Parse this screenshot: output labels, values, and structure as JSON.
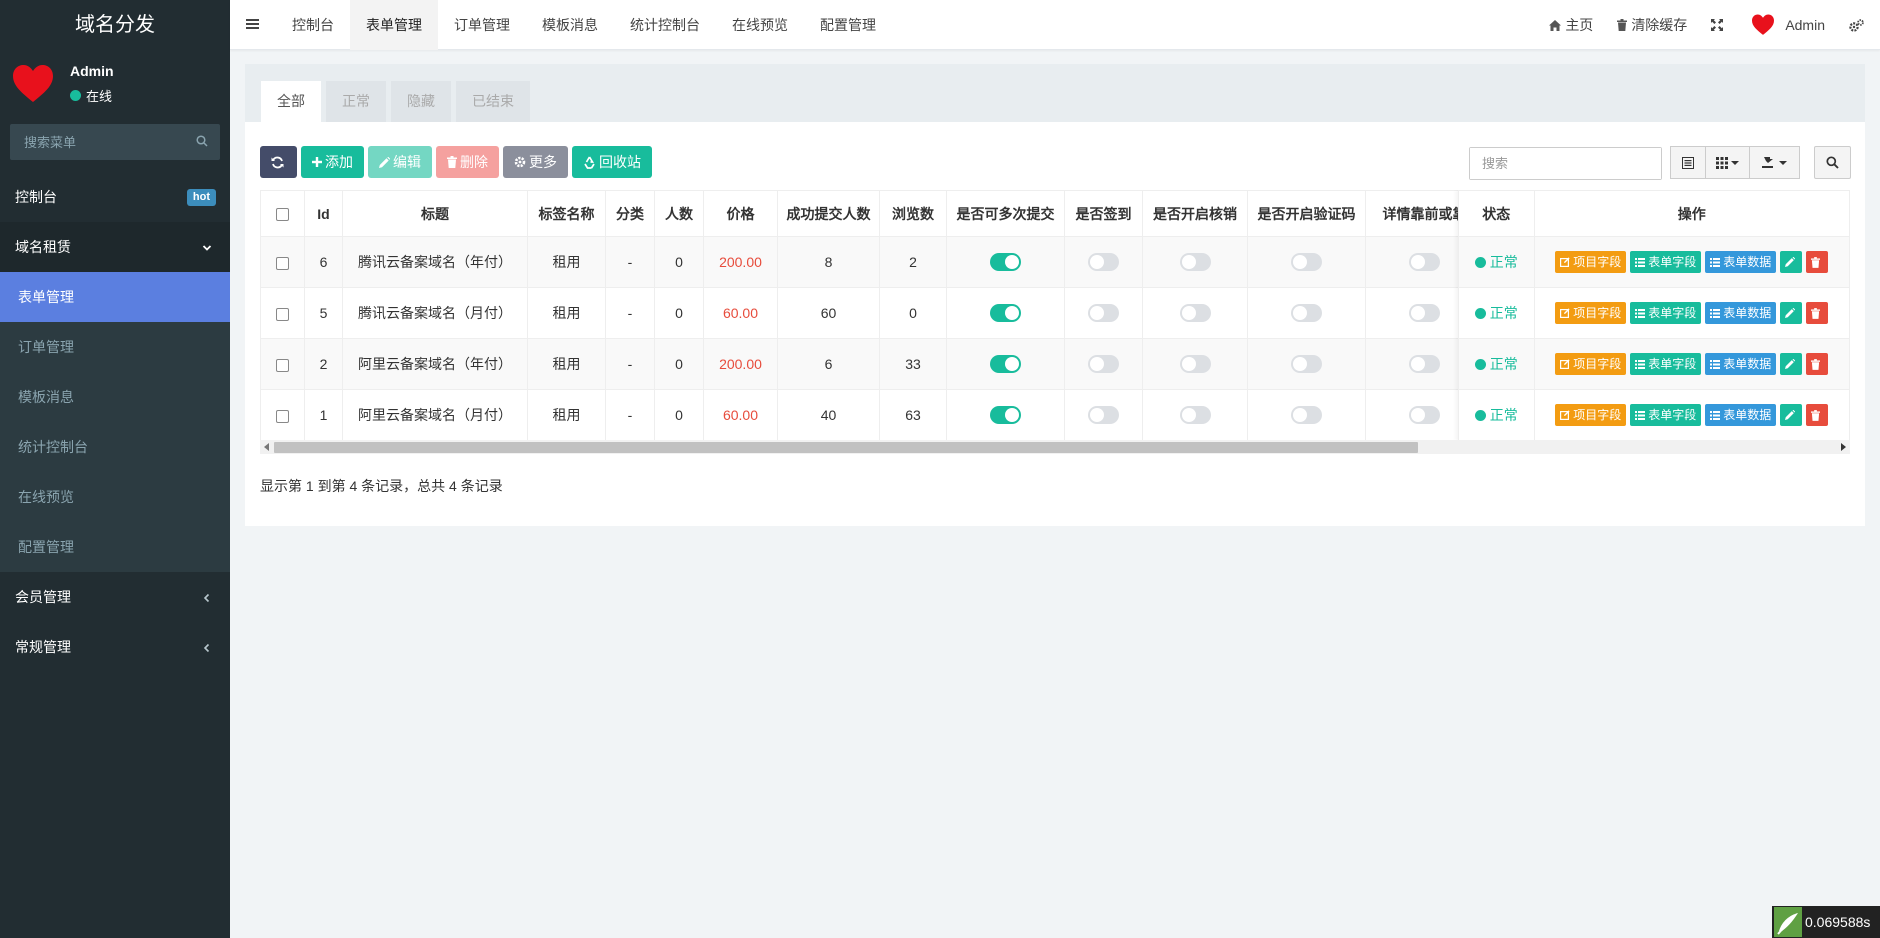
{
  "sidebar": {
    "logo": "域名分发",
    "user": {
      "name": "Admin",
      "status": "在线"
    },
    "search_placeholder": "搜索菜单",
    "dashboard": {
      "label": "控制台",
      "badge": "hot"
    },
    "group": {
      "label": "域名租赁"
    },
    "subitems": [
      "表单管理",
      "订单管理",
      "模板消息",
      "统计控制台",
      "在线预览",
      "配置管理"
    ],
    "member": "会员管理",
    "general": "常规管理"
  },
  "topbar": {
    "tabs": [
      "控制台",
      "表单管理",
      "订单管理",
      "模板消息",
      "统计控制台",
      "在线预览",
      "配置管理"
    ],
    "home": "主页",
    "clear_cache": "清除缓存",
    "user": "Admin"
  },
  "panel": {
    "tabs": [
      "全部",
      "正常",
      "隐藏",
      "已结束"
    ],
    "buttons": {
      "add": "添加",
      "edit": "编辑",
      "delete": "删除",
      "more": "更多",
      "recycle": "回收站"
    },
    "search_placeholder": "搜索"
  },
  "table": {
    "headers": [
      "Id",
      "标题",
      "标签名称",
      "分类",
      "人数",
      "价格",
      "成功提交人数",
      "浏览数",
      "是否可多次提交",
      "是否签到",
      "是否开启核销",
      "是否开启验证码",
      "详情靠前或靠"
    ],
    "fixed_headers": [
      "状态",
      "操作"
    ],
    "rows": [
      {
        "id": "6",
        "title": "腾讯云备案域名（年付）",
        "tag": "租用",
        "category": "-",
        "people": "0",
        "price": "200.00",
        "success": "8",
        "views": "2",
        "multi": true,
        "signin": false,
        "verify": false,
        "captcha": false,
        "front": false,
        "status": "正常"
      },
      {
        "id": "5",
        "title": "腾讯云备案域名（月付）",
        "tag": "租用",
        "category": "-",
        "people": "0",
        "price": "60.00",
        "success": "60",
        "views": "0",
        "multi": true,
        "signin": false,
        "verify": false,
        "captcha": false,
        "front": false,
        "status": "正常"
      },
      {
        "id": "2",
        "title": "阿里云备案域名（年付）",
        "tag": "租用",
        "category": "-",
        "people": "0",
        "price": "200.00",
        "success": "6",
        "views": "33",
        "multi": true,
        "signin": false,
        "verify": false,
        "captcha": false,
        "front": false,
        "status": "正常"
      },
      {
        "id": "1",
        "title": "阿里云备案域名（月付）",
        "tag": "租用",
        "category": "-",
        "people": "0",
        "price": "60.00",
        "success": "40",
        "views": "63",
        "multi": true,
        "signin": false,
        "verify": false,
        "captcha": false,
        "front": false,
        "status": "正常"
      }
    ],
    "ops": {
      "project": "项目字段",
      "form": "表单字段",
      "data": "表单数据"
    }
  },
  "pageinfo": "显示第 1 到第 4 条记录，总共 4 条记录",
  "timer": "0.069588s",
  "colors": {
    "accent": "#18bc9c",
    "sidebar": "#222d32",
    "active": "#5b7fe0",
    "price": "#e74c3c"
  }
}
